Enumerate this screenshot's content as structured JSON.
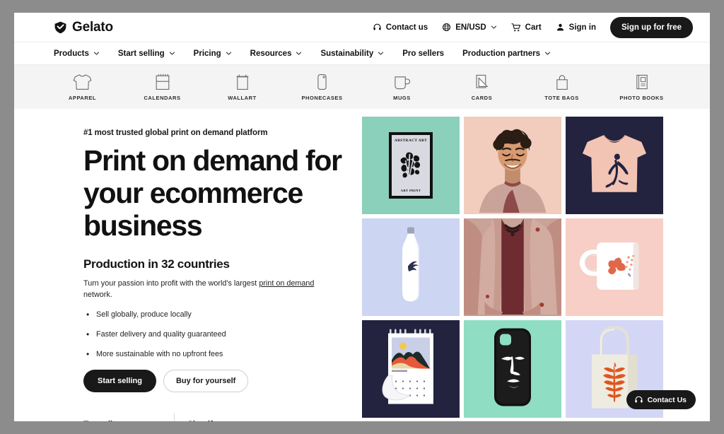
{
  "brand": {
    "name": "Gelato",
    "logo_icon": "gelato-diamond-check-icon"
  },
  "header": {
    "contact": {
      "label": "Contact us",
      "icon": "headset-icon"
    },
    "locale": {
      "label": "EN/USD",
      "icon": "globe-icon",
      "chevron": "chevron-down-icon"
    },
    "cart": {
      "label": "Cart",
      "icon": "shopping-cart-icon"
    },
    "signin": {
      "label": "Sign in",
      "icon": "user-icon"
    },
    "signup": {
      "label": "Sign up for free"
    }
  },
  "nav": {
    "items": [
      {
        "label": "Products",
        "has_chevron": true
      },
      {
        "label": "Start selling",
        "has_chevron": true
      },
      {
        "label": "Pricing",
        "has_chevron": true
      },
      {
        "label": "Resources",
        "has_chevron": true
      },
      {
        "label": "Sustainability",
        "has_chevron": true
      },
      {
        "label": "Pro sellers",
        "has_chevron": false
      },
      {
        "label": "Production partners",
        "has_chevron": true
      }
    ]
  },
  "categories": [
    {
      "label": "APPAREL",
      "icon": "tshirt-icon"
    },
    {
      "label": "CALENDARS",
      "icon": "calendar-icon"
    },
    {
      "label": "WALLART",
      "icon": "framed-print-icon"
    },
    {
      "label": "PHONECASES",
      "icon": "phone-case-icon"
    },
    {
      "label": "MUGS",
      "icon": "mug-icon"
    },
    {
      "label": "CARDS",
      "icon": "cards-icon"
    },
    {
      "label": "TOTE BAGS",
      "icon": "tote-bag-icon"
    },
    {
      "label": "PHOTO BOOKS",
      "icon": "photo-book-icon"
    }
  ],
  "hero": {
    "eyebrow": "#1 most trusted global print on demand platform",
    "headline": "Print on demand for your ecommerce business",
    "subhead": "Production in 32 countries",
    "lede_before": "Turn your passion into profit with the world's largest ",
    "lede_link": "print on demand",
    "lede_after": " network.",
    "bullets": [
      "Sell globally, produce locally",
      "Faster delivery and quality guaranteed",
      "More sustainable with no upfront fees"
    ],
    "cta_primary": "Start selling",
    "cta_secondary": "Buy for yourself",
    "trust": [
      {
        "label": "Trustpilot"
      },
      {
        "label": "Shopify"
      }
    ]
  },
  "gallery": {
    "tiles": [
      {
        "name": "wall-art-poster-tile",
        "alt": "Abstract art framed print on mint background",
        "bg": "#8ad0bb",
        "poster_title": "ABSTRACT ART",
        "poster_caption": "ART PRINT"
      },
      {
        "name": "model-portrait-tile",
        "alt": "Smiling man in pink jacket on peach background",
        "bg": "#f2cdbd"
      },
      {
        "name": "tshirt-tile",
        "alt": "Pink t-shirt with dancer print on navy background",
        "bg": "#23223f",
        "product_color": "#f2c4b4"
      },
      {
        "name": "water-bottle-tile",
        "alt": "White water bottle with bird print on periwinkle background",
        "bg": "#ccd5f2"
      },
      {
        "name": "model-portrait-lower-tile",
        "alt": "Lower portion of model portrait",
        "bg": "#c89a91"
      },
      {
        "name": "mug-tile",
        "alt": "White mug with orange flower print on blush background",
        "bg": "#f7cfc6",
        "product_color": "#e2674a"
      },
      {
        "name": "calendar-tile",
        "alt": "Wall calendar with landscape illustration on navy background",
        "bg": "#23223f"
      },
      {
        "name": "phone-case-tile",
        "alt": "Black phone case with line-art face on mint background",
        "bg": "#8fddc2"
      },
      {
        "name": "tote-bag-tile",
        "alt": "Canvas tote bag with orange leaf print on lilac background",
        "bg": "#d4d6f5",
        "product_color": "#e0551f"
      }
    ]
  },
  "fab": {
    "label": "Contact Us",
    "icon": "headset-icon"
  },
  "colors": {
    "ink": "#19191a",
    "page_bg": "#ffffff",
    "strip_bg": "#f4f4f4",
    "browser_chrome": "#8c8c8c"
  }
}
